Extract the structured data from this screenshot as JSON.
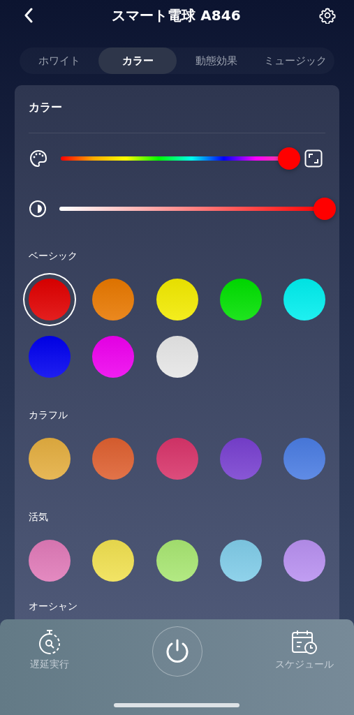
{
  "header": {
    "title": "スマート電球 A846"
  },
  "tabs": [
    {
      "label": "ホワイト",
      "selected": false
    },
    {
      "label": "カラー",
      "selected": true
    },
    {
      "label": "動態効果",
      "selected": false
    },
    {
      "label": "ミュージック",
      "selected": false
    }
  ],
  "card": {
    "title": "カラー",
    "hue_slider": {
      "level": 1
    },
    "brightness_slider": {
      "level": 1
    },
    "sections": [
      {
        "title": "ベーシック",
        "swatches": [
          {
            "color": "#e00000",
            "selected": true
          },
          {
            "color": "#e87800",
            "selected": false
          },
          {
            "color": "#f2ea00",
            "selected": false
          },
          {
            "color": "#00e000",
            "selected": false
          },
          {
            "color": "#00eeee",
            "selected": false
          },
          {
            "color": "#0000ee",
            "selected": false
          },
          {
            "color": "#ee00ee",
            "selected": false
          },
          {
            "color": "#e6e6e6",
            "selected": false
          }
        ]
      },
      {
        "title": "カラフル",
        "swatches": [
          {
            "color": "#e4ae40",
            "selected": false
          },
          {
            "color": "#de6030",
            "selected": false
          },
          {
            "color": "#d8346a",
            "selected": false
          },
          {
            "color": "#7840d0",
            "selected": false
          },
          {
            "color": "#4a7ce2",
            "selected": false
          }
        ]
      },
      {
        "title": "活気",
        "swatches": [
          {
            "color": "#e07ab8",
            "selected": false
          },
          {
            "color": "#f0e050",
            "selected": false
          },
          {
            "color": "#a8e672",
            "selected": false
          },
          {
            "color": "#80cce8",
            "selected": false
          },
          {
            "color": "#b890f0",
            "selected": false
          }
        ]
      },
      {
        "title": "オーシャン"
      }
    ]
  },
  "bottom_bar": {
    "left_label": "遅延実行",
    "right_label": "スケジュール"
  }
}
